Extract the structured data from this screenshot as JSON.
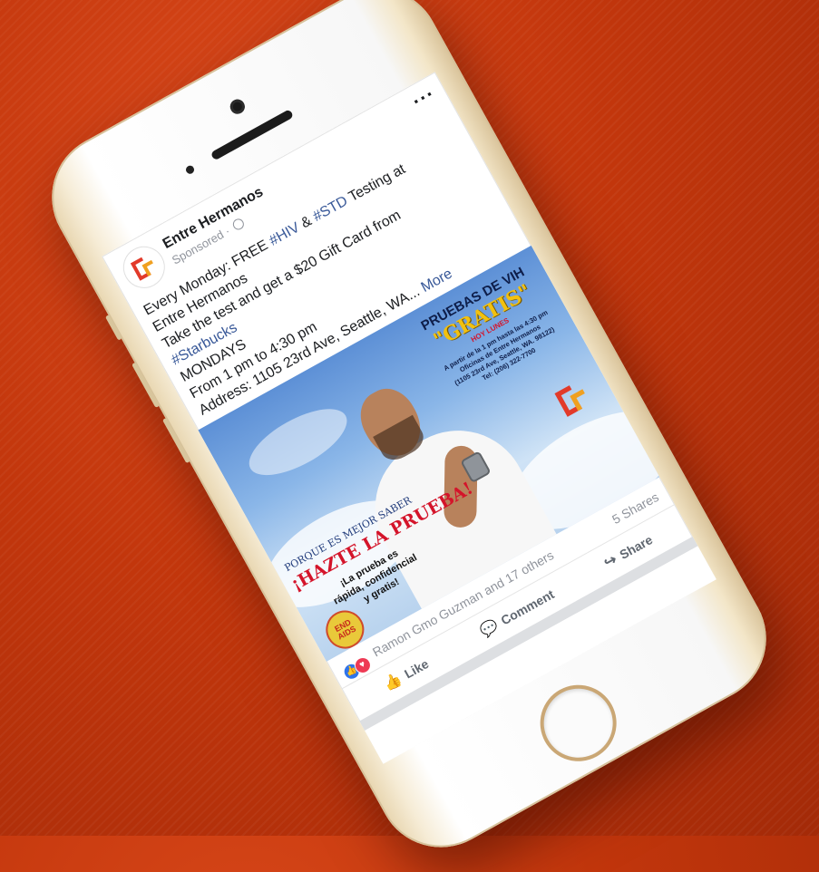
{
  "post": {
    "page_name": "Entre Hermanos",
    "sponsored": "Sponsored ·",
    "text": {
      "l1_a": "Every Monday: FREE ",
      "tag1": "#HIV",
      "amp": " & ",
      "tag2": "#STD",
      "l1_b": " Testing at",
      "l2": "Entre Hermanos",
      "l3": "Take the test and get a $20 Gift Card from",
      "tag3": "#Starbucks",
      "l5": "MONDAYS",
      "l6": "From 1 pm to 4:30 pm",
      "l7": "Address: 1105 23rd Ave, Seattle, WA...",
      "more": "More"
    },
    "ad": {
      "tagline": "PORQUE ES MEJOR SABER",
      "headline": "¡HAZTE LA PRUEBA!",
      "sub": "¡La prueba es rápida, confidencial y gratis!",
      "badge": "END AIDS",
      "pruebas_title": "PRUEBAS DE VIH",
      "gratis": "\"GRATIS\"",
      "day": "HOY LUNES",
      "info1": "A partir de la 1 pm hasta las 4:30 pm",
      "info2": "Oficinas de Entre Hermanos",
      "info3": "(1105 23rd Ave, Seattle, WA. 98122)",
      "info4": "Tel: (206) 322-7700"
    },
    "reactions_text": "Ramon Gmo Guzman and 17 others",
    "shares": "5 Shares",
    "actions": {
      "like": "Like",
      "comment": "Comment",
      "share": "Share"
    }
  },
  "colors": {
    "background": "#c2360c",
    "link": "#385898",
    "like_blue": "#2f74ea",
    "love_red": "#ee3a55",
    "headline_red": "#d4142a",
    "gratis_gold": "#f2c10f"
  },
  "icons": {
    "more": "more-dots-icon",
    "globe": "globe-icon",
    "like": "thumbs-up-icon",
    "comment": "comment-bubble-icon",
    "share": "share-arrow-icon"
  }
}
